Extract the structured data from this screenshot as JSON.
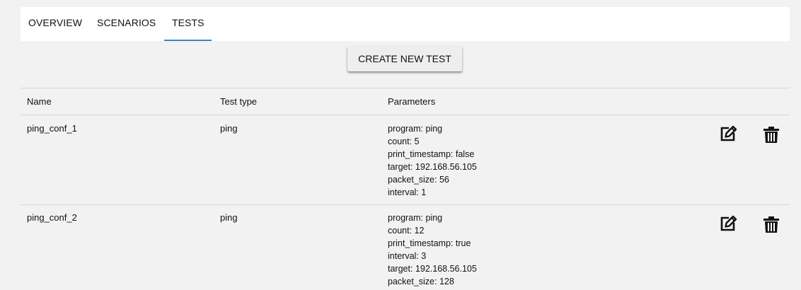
{
  "tabs": [
    {
      "label": "OVERVIEW"
    },
    {
      "label": "SCENARIOS"
    },
    {
      "label": "TESTS"
    }
  ],
  "create_button_label": "CREATE NEW TEST",
  "table": {
    "headers": {
      "name": "Name",
      "type": "Test type",
      "params": "Parameters"
    },
    "rows": [
      {
        "name": "ping_conf_1",
        "type": "ping",
        "params": [
          "program: ping",
          "count: 5",
          "print_timestamp: false",
          "target: 192.168.56.105",
          "packet_size: 56",
          "interval: 1"
        ]
      },
      {
        "name": "ping_conf_2",
        "type": "ping",
        "params": [
          "program: ping",
          "count: 12",
          "print_timestamp: true",
          "interval: 3",
          "target: 192.168.56.105",
          "packet_size: 128"
        ]
      }
    ]
  },
  "icons": {
    "edit": "edit-icon",
    "delete": "trash-icon"
  },
  "colors": {
    "accent": "#3b83c8",
    "background": "#f2f2f2"
  }
}
